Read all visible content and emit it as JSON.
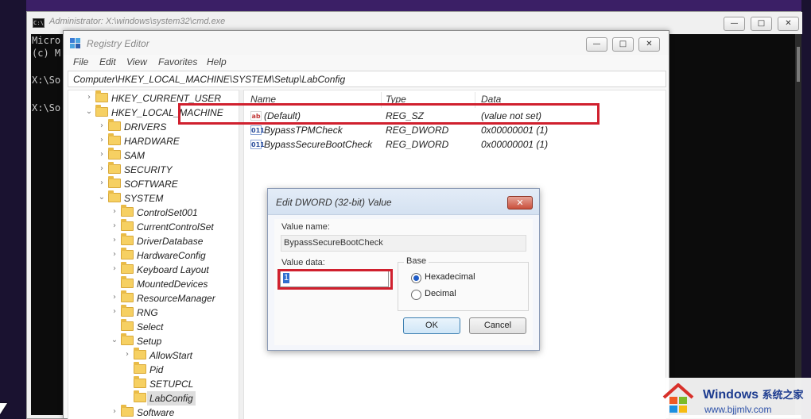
{
  "cmd": {
    "title": "Administrator: X:\\windows\\system32\\cmd.exe",
    "icon_text": "C:\\",
    "lines": [
      "Micro",
      "(c) M",
      "X:\\So",
      "X:\\So"
    ],
    "minimize_glyph": "—",
    "maximize_glyph": "□",
    "close_glyph": "✕"
  },
  "regedit": {
    "title": "Registry Editor",
    "menu": [
      "File",
      "Edit",
      "View",
      "Favorites",
      "Help"
    ],
    "address": "Computer\\HKEY_LOCAL_MACHINE\\SYSTEM\\Setup\\LabConfig",
    "minimize_glyph": "—",
    "maximize_glyph": "□",
    "close_glyph": "✕",
    "tree": [
      {
        "label": "HKEY_CURRENT_USER",
        "chevron": "›"
      },
      {
        "label": "HKEY_LOCAL_MACHINE",
        "chevron": "⌄"
      },
      {
        "label": "DRIVERS",
        "chevron": "›"
      },
      {
        "label": "HARDWARE",
        "chevron": "›"
      },
      {
        "label": "SAM",
        "chevron": "›"
      },
      {
        "label": "SECURITY",
        "chevron": "›"
      },
      {
        "label": "SOFTWARE",
        "chevron": "›"
      },
      {
        "label": "SYSTEM",
        "chevron": "⌄"
      },
      {
        "label": "ControlSet001",
        "chevron": "›"
      },
      {
        "label": "CurrentControlSet",
        "chevron": "›"
      },
      {
        "label": "DriverDatabase",
        "chevron": "›"
      },
      {
        "label": "HardwareConfig",
        "chevron": "›"
      },
      {
        "label": "Keyboard Layout",
        "chevron": "›"
      },
      {
        "label": "MountedDevices",
        "chevron": ""
      },
      {
        "label": "ResourceManager",
        "chevron": "›"
      },
      {
        "label": "RNG",
        "chevron": "›"
      },
      {
        "label": "Select",
        "chevron": ""
      },
      {
        "label": "Setup",
        "chevron": "⌄"
      },
      {
        "label": "AllowStart",
        "chevron": "›"
      },
      {
        "label": "Pid",
        "chevron": ""
      },
      {
        "label": "SETUPCL",
        "chevron": ""
      },
      {
        "label": "LabConfig",
        "chevron": ""
      },
      {
        "label": "Software",
        "chevron": "›"
      }
    ],
    "columns": {
      "name": "Name",
      "type": "Type",
      "data": "Data"
    },
    "values": [
      {
        "name": "(Default)",
        "type": "REG_SZ",
        "data": "(value not set)",
        "icon": "ab"
      },
      {
        "name": "BypassTPMCheck",
        "type": "REG_DWORD",
        "data": "0x00000001 (1)",
        "icon": "011"
      },
      {
        "name": "BypassSecureBootCheck",
        "type": "REG_DWORD",
        "data": "0x00000001 (1)",
        "icon": "011"
      }
    ]
  },
  "dialog": {
    "title": "Edit DWORD (32-bit) Value",
    "close_glyph": "✕",
    "value_name_label": "Value name:",
    "value_name": "BypassSecureBootCheck",
    "value_data_label": "Value data:",
    "value_data": "1",
    "base_label": "Base",
    "hex_label": "Hexadecimal",
    "dec_label": "Decimal",
    "base_selected": "hexadecimal",
    "ok_label": "OK",
    "cancel_label": "Cancel"
  },
  "watermark": {
    "brand": "Windows",
    "brand_cn": "系统之家",
    "url": "www.bjjmlv.com"
  },
  "colors": {
    "highlight_red": "#d0202e",
    "console_bg": "#0c0c0c",
    "folder": "#f6d062",
    "watermark_blue": "#1c3b8f"
  }
}
